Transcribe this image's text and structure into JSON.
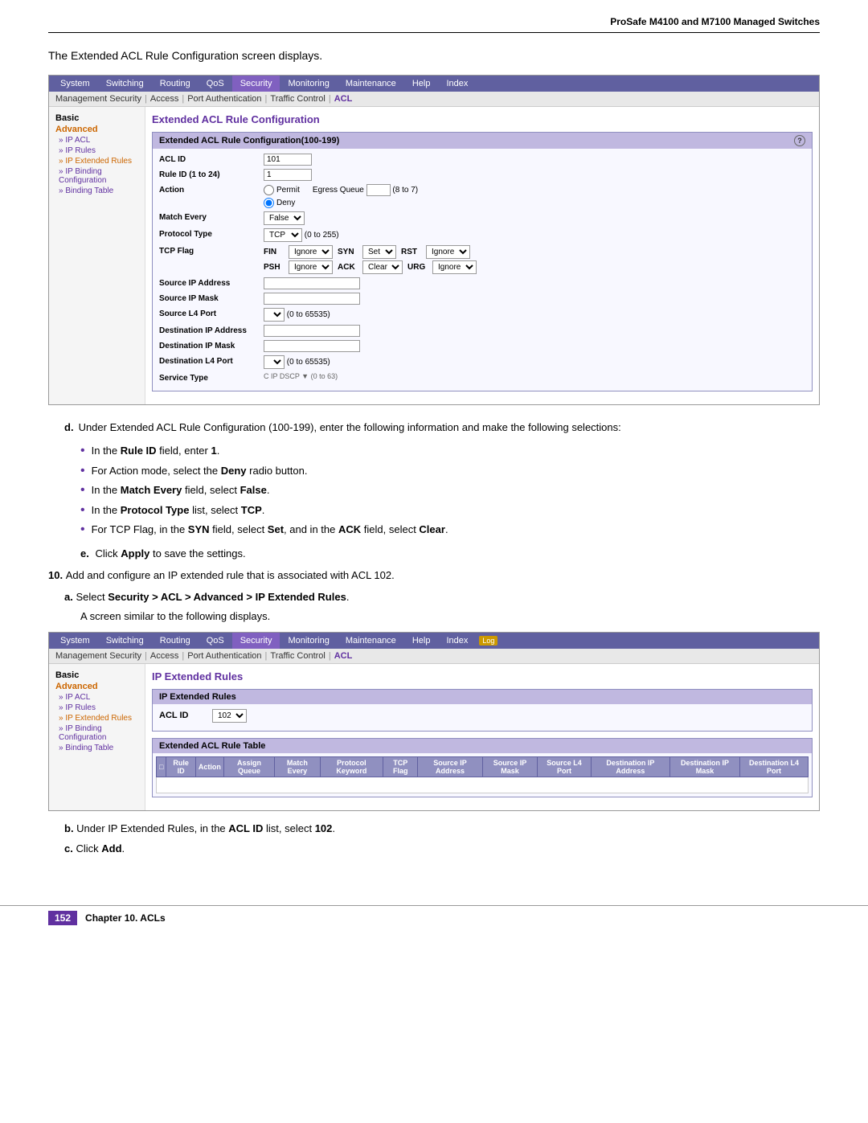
{
  "header": {
    "title": "ProSafe M4100 and M7100 Managed Switches"
  },
  "intro": {
    "text": "The Extended ACL Rule Configuration screen displays."
  },
  "screenshot1": {
    "nav": {
      "items": [
        "System",
        "Switching",
        "Routing",
        "QoS",
        "Security",
        "Monitoring",
        "Maintenance",
        "Help",
        "Index"
      ],
      "active": "Security"
    },
    "subnav": {
      "items": [
        "Management Security",
        "Access",
        "Port Authentication",
        "Traffic Control",
        "ACL"
      ],
      "active": "ACL"
    },
    "sidebar": {
      "section1": "Basic",
      "section2": "Advanced",
      "links": [
        {
          "label": "» IP ACL",
          "active": false
        },
        {
          "label": "» IP Rules",
          "active": false
        },
        {
          "label": "» IP Extended Rules",
          "active": true
        },
        {
          "label": "» IP Binding Configuration",
          "active": false
        },
        {
          "label": "» Binding Table",
          "active": false
        }
      ]
    },
    "main": {
      "title": "Extended ACL Rule Configuration",
      "configBox": {
        "header": "Extended ACL Rule Configuration(100-199)",
        "fields": {
          "aclId": {
            "label": "ACL ID",
            "value": "101"
          },
          "ruleId": {
            "label": "Rule ID (1 to 24)",
            "value": "1"
          },
          "action": {
            "label": "Action",
            "permit": "Permit",
            "deny": "Deny",
            "egressQueue": "Egress Queue",
            "egressRange": "(8 to 7)",
            "selected": "Deny"
          },
          "matchEvery": {
            "label": "Match Every",
            "value": "False"
          },
          "protocolType": {
            "label": "Protocol Type",
            "value": "TCP",
            "range": "(0 to 255)"
          },
          "tcpFlag": {
            "label": "TCP Flag",
            "fin": "FIN",
            "syn": "SYN",
            "rst": "RST",
            "psh": "PSH",
            "ack": "ACK",
            "urg": "URG",
            "finValue": "Ignore",
            "synValue": "Set",
            "rstValue": "Ignore",
            "pshValue": "Ignore",
            "ackValue": "Clear",
            "urgValue": "Ignore"
          },
          "sourceIpAddress": {
            "label": "Source IP Address"
          },
          "sourceIpMask": {
            "label": "Source IP Mask"
          },
          "sourceL4Port": {
            "label": "Source L4 Port",
            "range": "(0 to 65535)"
          },
          "destIpAddress": {
            "label": "Destination IP Address"
          },
          "destIpMask": {
            "label": "Destination IP Mask"
          },
          "destL4Port": {
            "label": "Destination L4 Port",
            "range": "(0 to 65535)"
          },
          "serviceType": {
            "label": "Service Type"
          }
        }
      }
    }
  },
  "instructions": {
    "intro": "Under Extended ACL Rule Configuration (100-199), enter the following information and make the following selections:",
    "bullets": [
      {
        "text": "In the ",
        "bold": "Rule ID",
        "rest": " field, enter ",
        "boldEnd": "1",
        "suffix": "."
      },
      {
        "text": "For Action mode, select the ",
        "bold": "Deny",
        "rest": " radio button.",
        "suffix": ""
      },
      {
        "text": "In the ",
        "bold": "Match Every",
        "rest": " field, select ",
        "boldEnd": "False",
        "suffix": "."
      },
      {
        "text": "In the ",
        "bold": "Protocol Type",
        "rest": " list, select ",
        "boldEnd": "TCP",
        "suffix": "."
      },
      {
        "text": "For TCP Flag, in the ",
        "bold": "SYN",
        "rest": " field, select ",
        "boldEnd": "Set",
        "rest2": ", and in the ",
        "bold2": "ACK",
        "rest3": " field, select ",
        "boldEnd2": "Clear",
        "suffix": "."
      }
    ],
    "clickApply": "Click ",
    "clickApplyBold": "Apply",
    "clickApplySuffix": " to save the settings."
  },
  "step10": {
    "text": "Add and configure an IP extended rule that is associated with ACL 102.",
    "stepA": {
      "text": "Select ",
      "bold": "Security > ACL > Advanced > IP Extended Rules",
      "suffix": "."
    },
    "subText": "A screen similar to the following displays."
  },
  "screenshot2": {
    "nav": {
      "items": [
        "System",
        "Switching",
        "Routing",
        "QoS",
        "Security",
        "Monitoring",
        "Maintenance",
        "Help",
        "Index"
      ],
      "active": "Security",
      "logBadge": "Log"
    },
    "subnav": {
      "items": [
        "Management Security",
        "Access",
        "Port Authentication",
        "Traffic Control",
        "ACL"
      ],
      "active": "ACL"
    },
    "sidebar": {
      "section1": "Basic",
      "section2": "Advanced",
      "links": [
        {
          "label": "» IP ACL",
          "active": false
        },
        {
          "label": "» IP Rules",
          "active": false
        },
        {
          "label": "» IP Extended Rules",
          "active": true
        },
        {
          "label": "» IP Binding Configuration",
          "active": false
        },
        {
          "label": "» Binding Table",
          "active": false
        }
      ]
    },
    "main": {
      "title": "IP Extended Rules",
      "aclIdLabel": "ACL ID",
      "aclIdValue": "102",
      "tableTitle": "Extended ACL Rule Table",
      "tableHeaders": [
        "Rule ID",
        "Action",
        "Assign Queue",
        "Match Every",
        "Protocol Keyword",
        "TCP Flag",
        "Source IP Address",
        "Source IP Mask",
        "Source L4 Port",
        "Destination IP Address",
        "Destination IP Mask",
        "Destination L4 Port"
      ]
    }
  },
  "stepB": {
    "text": "Under IP Extended Rules, in the ",
    "bold": "ACL ID",
    "rest": " list, select ",
    "boldEnd": "102",
    "suffix": "."
  },
  "stepC": {
    "text": "Click ",
    "bold": "Add",
    "suffix": "."
  },
  "footer": {
    "pageNum": "152",
    "chapter": "Chapter 10. ACLs"
  }
}
